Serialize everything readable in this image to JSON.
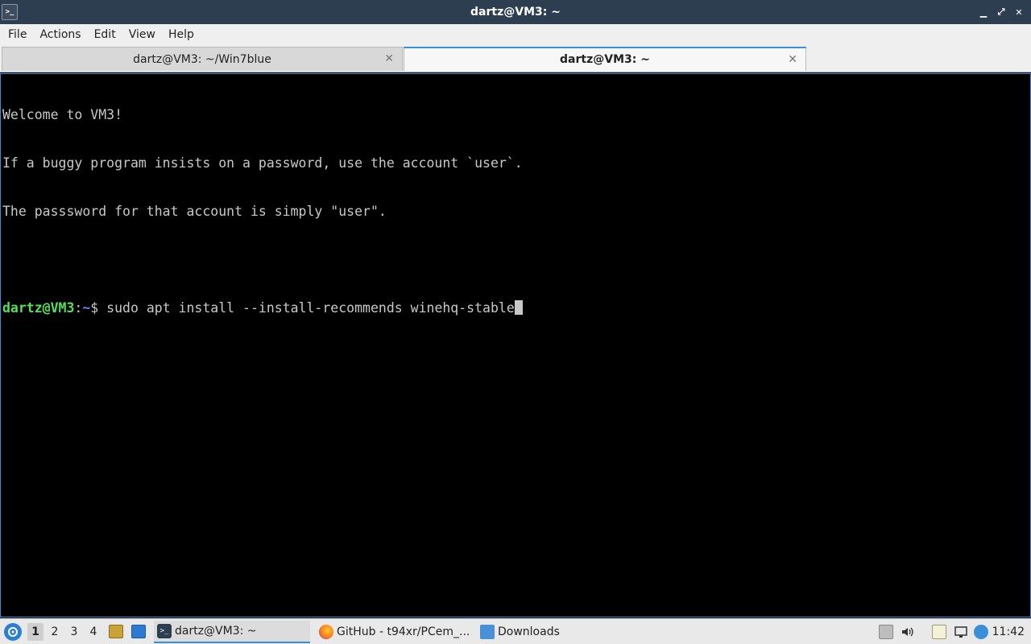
{
  "window": {
    "title": "dartz@VM3: ~",
    "app_icon_glyph": ">_",
    "minimize_glyph": "▁",
    "maximize_glyph": "⤢",
    "close_glyph": "✕"
  },
  "menubar": {
    "items": [
      "File",
      "Actions",
      "Edit",
      "View",
      "Help"
    ]
  },
  "tabs": [
    {
      "label": "dartz@VM3: ~/Win7blue",
      "active": false,
      "close_glyph": "✕"
    },
    {
      "label": "dartz@VM3: ~",
      "active": true,
      "close_glyph": "✕"
    }
  ],
  "terminal": {
    "lines": [
      "Welcome to VM3!",
      "If a buggy program insists on a password, use the account `user`.",
      "The passsword for that account is simply \"user\".",
      ""
    ],
    "prompt": {
      "user_host": "dartz@VM3",
      "colon": ":",
      "path": "~",
      "symbol": "$ ",
      "command": "sudo apt install --install-recommends winehq-stable"
    }
  },
  "taskbar": {
    "workspaces": [
      "1",
      "2",
      "3",
      "4"
    ],
    "active_workspace": "1",
    "tasks": [
      {
        "label": "dartz@VM3: ~",
        "icon": "terminal-icon",
        "active": true
      },
      {
        "label": "GitHub - t94xr/PCem_...",
        "icon": "firefox-icon",
        "active": false
      },
      {
        "label": "Downloads",
        "icon": "folder-icon",
        "active": false
      }
    ],
    "clock": "11:42"
  },
  "colors": {
    "titlebar": "#2c3e50",
    "accent": "#3a8fd9",
    "prompt_user": "#55e055",
    "prompt_path": "#6f7fff",
    "terminal_bg": "#000000",
    "terminal_fg": "#c8c8c8"
  }
}
